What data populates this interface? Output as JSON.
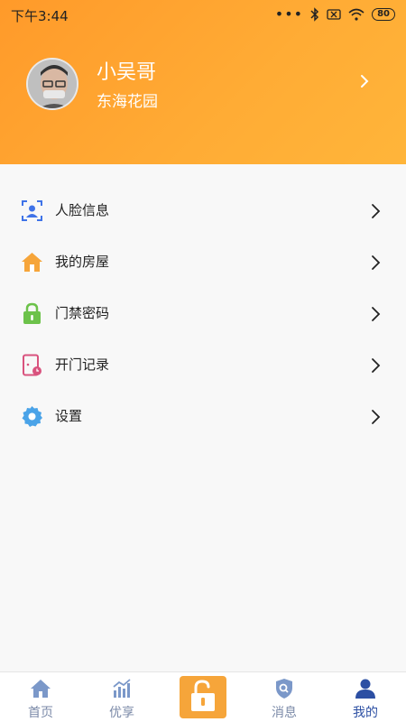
{
  "status_bar": {
    "time": "下午3:44",
    "dots": "•••",
    "battery": "80"
  },
  "profile": {
    "name": "小吴哥",
    "community": "东海花园"
  },
  "menu": {
    "items": [
      {
        "label": "人脸信息",
        "icon": "face-id-icon"
      },
      {
        "label": "我的房屋",
        "icon": "home-icon"
      },
      {
        "label": "门禁密码",
        "icon": "lock-icon"
      },
      {
        "label": "开门记录",
        "icon": "door-record-icon"
      },
      {
        "label": "设置",
        "icon": "gear-icon"
      }
    ]
  },
  "tabbar": {
    "tabs": [
      {
        "label": "首页",
        "icon": "home-icon"
      },
      {
        "label": "优享",
        "icon": "chart-icon"
      },
      {
        "label": "消息",
        "icon": "shield-search-icon"
      },
      {
        "label": "我的",
        "icon": "user-icon"
      }
    ],
    "active": "我的"
  },
  "colors": {
    "header_gradient_start": "#ff9a2a",
    "header_gradient_end": "#ffb53a",
    "tab_inactive": "#7b8aa8",
    "tab_active": "#2c4fa3",
    "unlock_button": "#f6a53a"
  }
}
